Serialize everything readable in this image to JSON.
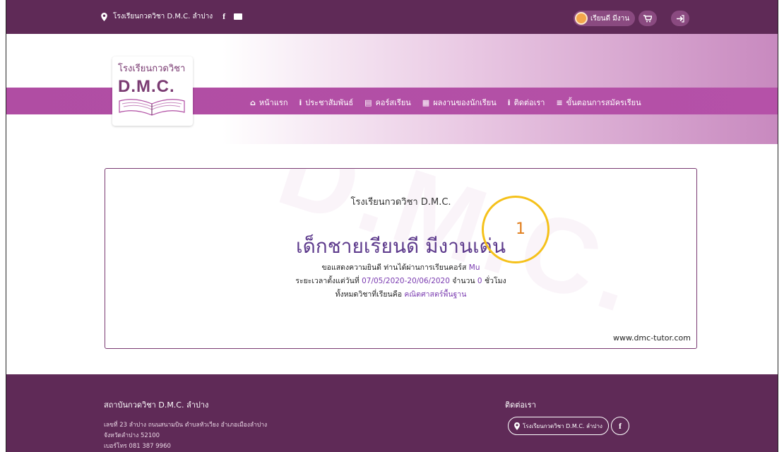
{
  "topbar": {
    "location_label": "โรงเรียนกวดวิชา D.M.C. ลำปาง",
    "facebook_glyph": "f",
    "user_label": "เรียนดี มีงาน",
    "cart_glyph": "🛒",
    "logout_glyph": "➜"
  },
  "logo": {
    "line1": "โรงเรียนกวดวิชา",
    "line2": "D.M.C."
  },
  "nav": {
    "home": "หน้าแรก",
    "news": "ประชาสัมพันธ์",
    "courses": "คอร์สเรียน",
    "works": "ผลงานของนักเรียน",
    "contact": "ติดต่อเรา",
    "steps": "ขั้นตอนการสมัครเรียน"
  },
  "certificate": {
    "watermark": "D.M.C.",
    "school": "โรงเรียนกวดวิชา D.M.C.",
    "student_name": "เด็กชายเรียนดี มีงานเด่น",
    "congrats_prefix": "ขอแสดงความยินดี ท่านได้ผ่านการเรียนคอร์ส",
    "course": "Mu",
    "period_prefix": "ระยะเวลาตั้งแต่วันที่",
    "period": "07/05/2020-20/06/2020",
    "hours_prefix": "จำนวน",
    "hours": "0",
    "hours_suffix": "ชั่วโมง",
    "subjects_prefix": "ทั้งหมดวิชาที่เรียนคือ",
    "subjects": "คณิตศาสตร์พื้นฐาน",
    "website": "www.dmc-tutor.com"
  },
  "annotation": {
    "number": "1"
  },
  "footer": {
    "title": "สถาบันกวดวิชา D.M.C. ลำปาง",
    "address1": "เลขที่ 23 ลำปาง ถนนสนามบิน ตำบลหัวเวียง อำเภอเมืองลำปาง",
    "address2": "จังหวัดลำปาง 52100",
    "phone": "เบอร์โทร 081 387 9960",
    "contact_title": "ติดต่อเรา",
    "contact_pill": "โรงเรียนกวดวิชา D.M.C. ลำปาง",
    "facebook_glyph": "f"
  },
  "colors": {
    "topbar": "#5f2a57",
    "band": "#b04da3",
    "accent": "#7a3bb0",
    "ring": "#f5c11a"
  }
}
